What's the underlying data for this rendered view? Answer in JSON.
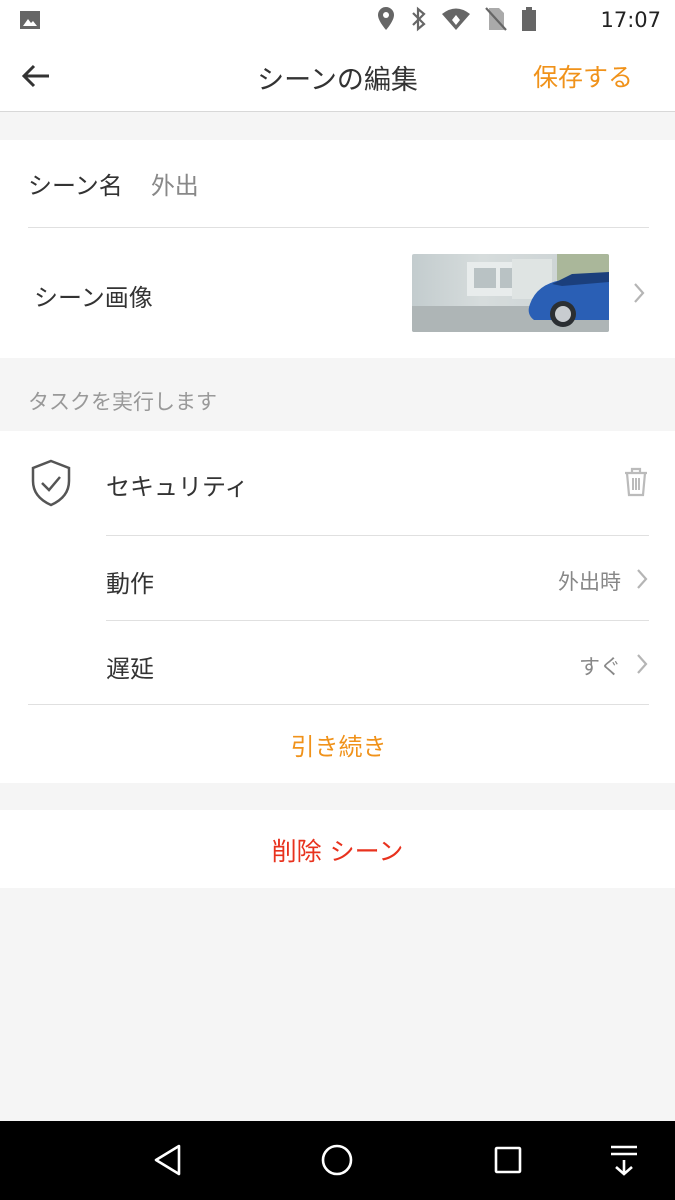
{
  "status_bar": {
    "time": "17:07"
  },
  "header": {
    "title": "シーンの編集",
    "save_label": "保存する"
  },
  "scene": {
    "name_label": "シーン名",
    "name_value": "外出",
    "image_label": "シーン画像"
  },
  "tasks": {
    "section_label": "タスクを実行します",
    "item": {
      "name": "セキュリティ",
      "action_label": "動作",
      "action_value": "外出時",
      "delay_label": "遅延",
      "delay_value": "すぐ"
    },
    "continue_label": "引き続き"
  },
  "delete_label": "削除 シーン",
  "colors": {
    "accent": "#f0921a",
    "danger": "#e8321e"
  }
}
